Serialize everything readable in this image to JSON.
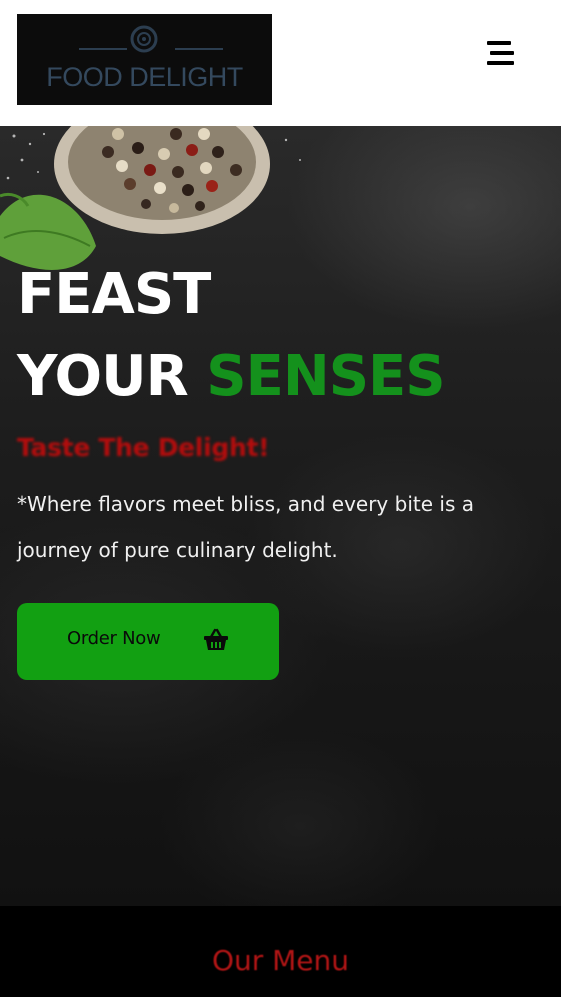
{
  "header": {
    "logo_text": "FOOD DELIGHT",
    "logo_icon": "dish-emblem-icon",
    "menu_icon": "hamburger-menu-icon"
  },
  "hero": {
    "title_line1": "FEAST",
    "title_line2_white": "YOUR",
    "title_line2_accent": "SENSES",
    "tagline": "Taste The Delight!",
    "description": "*Where flavors meet bliss, and every bite is a journey of pure culinary delight.",
    "cta_label": "Order Now",
    "cta_icon": "shopping-basket-icon"
  },
  "menu_section": {
    "heading": "Our Menu"
  },
  "colors": {
    "accent_green": "#14911c",
    "button_green": "#12a012",
    "tagline_red": "#b30d0d",
    "heading_red": "#b01515",
    "hero_background": "#1d1d1d",
    "header_background": "#ffffff"
  }
}
